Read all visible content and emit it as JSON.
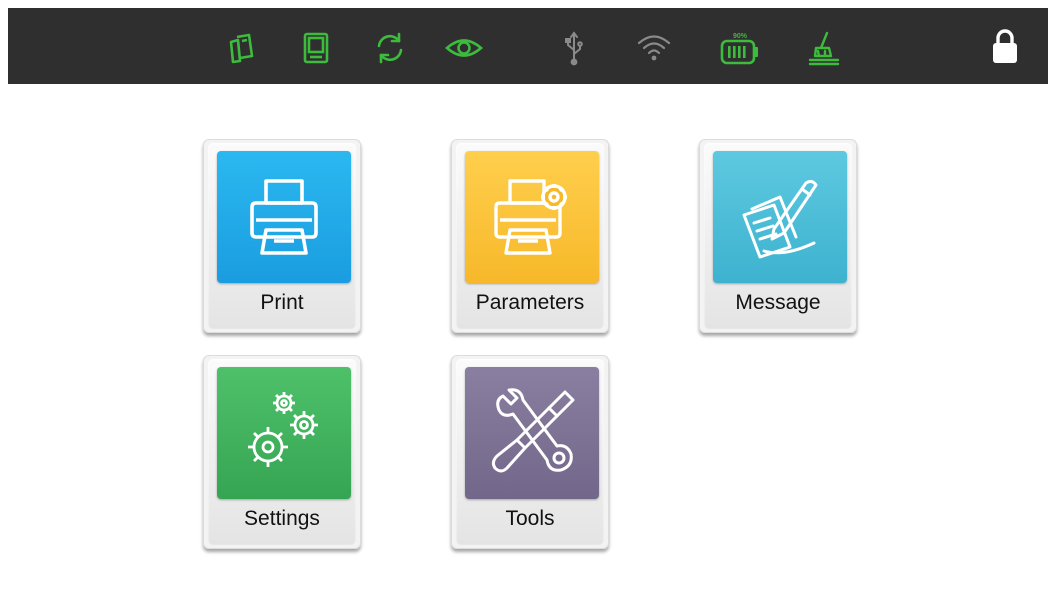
{
  "status_bar": {
    "battery_level_label": "90%",
    "icons": [
      "cards-icon",
      "tablet-icon",
      "sync-icon",
      "eye-icon",
      "usb-icon",
      "wifi-icon",
      "battery-icon",
      "cleaning-icon"
    ],
    "lock": "lock-icon",
    "colors": {
      "active": "#3dbb3d",
      "inactive": "#8a8a8a",
      "background": "#2f2f2f"
    }
  },
  "tiles": [
    {
      "id": "print",
      "label": "Print",
      "icon": "printer-icon",
      "color": "#1fa8e8"
    },
    {
      "id": "parameters",
      "label": "Parameters",
      "icon": "printer-gear-icon",
      "color": "#fbc23a"
    },
    {
      "id": "message",
      "label": "Message",
      "icon": "document-pen-icon",
      "color": "#4bbdd6"
    },
    {
      "id": "settings",
      "label": "Settings",
      "icon": "gears-icon",
      "color": "#3fb45e"
    },
    {
      "id": "tools",
      "label": "Tools",
      "icon": "wrench-screwdriver-icon",
      "color": "#7d7295"
    }
  ]
}
